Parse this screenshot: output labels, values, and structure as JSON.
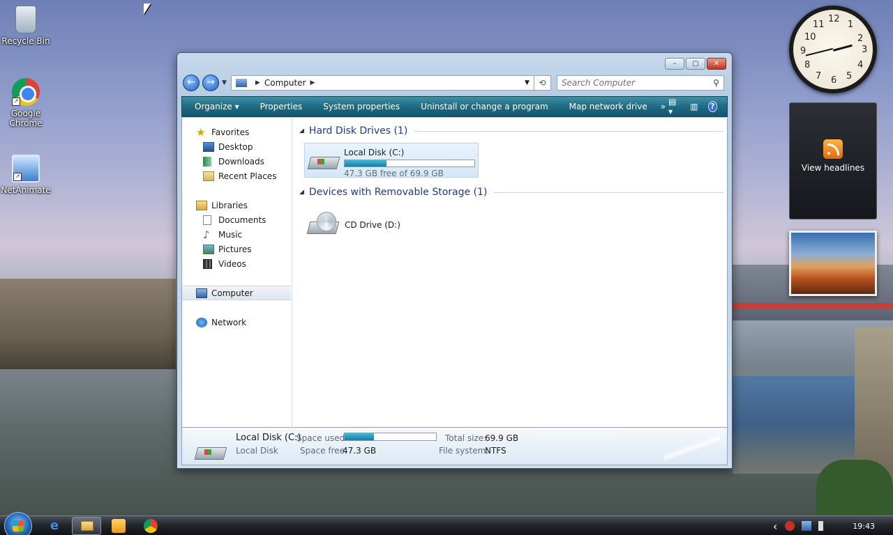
{
  "desktop": {
    "icons": [
      {
        "label": "Recycle Bin",
        "icon": "recycle-bin-icon"
      },
      {
        "label": "Google Chrome",
        "icon": "chrome-icon"
      },
      {
        "label": "NetAnimate",
        "icon": "network-computer-icon"
      }
    ],
    "gadgets": {
      "clock": {
        "numbers": [
          "12",
          "1",
          "2",
          "3",
          "4",
          "5",
          "6",
          "7",
          "8",
          "9",
          "10",
          "11"
        ]
      },
      "feed": {
        "label": "View headlines",
        "icon": "rss-icon"
      },
      "slideshow": {
        "icon": "desert-photo"
      }
    }
  },
  "window": {
    "title_buttons": {
      "minimize": "–",
      "maximize": "▢",
      "close": "✕"
    },
    "address": {
      "location": "Computer"
    },
    "search": {
      "placeholder": "Search Computer"
    },
    "toolbar": {
      "organize": "Organize",
      "properties": "Properties",
      "system_properties": "System properties",
      "uninstall": "Uninstall or change a program",
      "map_drive": "Map network drive",
      "more": "»",
      "help": "?"
    },
    "nav": {
      "favorites": "Favorites",
      "desktop": "Desktop",
      "downloads": "Downloads",
      "recent": "Recent Places",
      "libraries": "Libraries",
      "documents": "Documents",
      "music": "Music",
      "pictures": "Pictures",
      "videos": "Videos",
      "computer": "Computer",
      "network": "Network"
    },
    "groups": {
      "hdd": "Hard Disk Drives (1)",
      "removable": "Devices with Removable Storage (1)"
    },
    "drives": {
      "c": {
        "name": "Local Disk (C:)",
        "free_text": "47.3 GB free of 69.9 GB",
        "used_fraction": 0.323
      },
      "d": {
        "name": "CD Drive (D:)"
      }
    },
    "details": {
      "name": "Local Disk (C:)",
      "type": "Local Disk",
      "space_used_label": "Space used:",
      "space_free_label": "Space free:",
      "space_free": "47.3 GB",
      "total_size_label": "Total size:",
      "total_size": "69.9 GB",
      "file_system_label": "File system:",
      "file_system": "NTFS"
    }
  },
  "taskbar": {
    "clock": "19:43",
    "tray_arrow": "‹"
  },
  "colors": {
    "accent": "#1f6b83",
    "progress": "#117fa8",
    "group_heading": "#1e3b8a"
  }
}
